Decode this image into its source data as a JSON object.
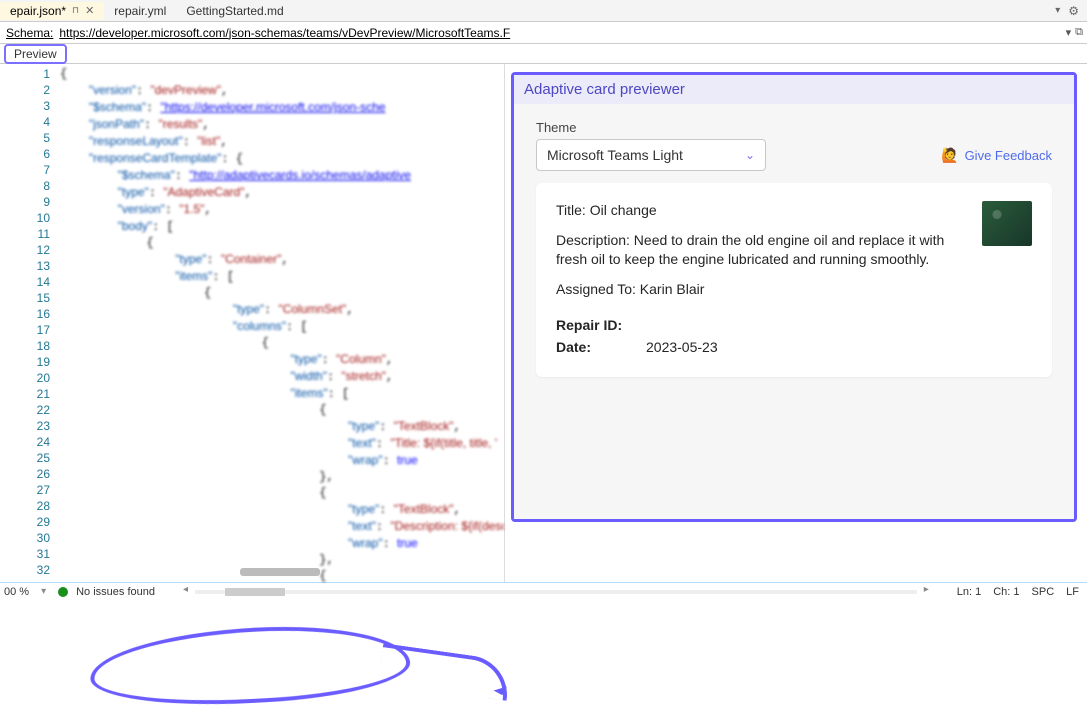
{
  "tabs": [
    {
      "label": "epair.json*",
      "active": true,
      "pinned": true,
      "closable": true
    },
    {
      "label": "repair.yml",
      "active": false
    },
    {
      "label": "GettingStarted.md",
      "active": false
    }
  ],
  "schema": {
    "label": "Schema:",
    "url": "https://developer.microsoft.com/json-schemas/teams/vDevPreview/MicrosoftTeams.F"
  },
  "preview_link": "Preview",
  "editor": {
    "lines": [
      "1",
      "2",
      "3",
      "4",
      "5",
      "6",
      "7",
      "8",
      "9",
      "10",
      "11",
      "12",
      "13",
      "14",
      "15",
      "16",
      "17",
      "18",
      "19",
      "20",
      "21",
      "22",
      "23",
      "24",
      "25",
      "26",
      "27",
      "28",
      "29",
      "30",
      "31",
      "32"
    ]
  },
  "code": {
    "l2": {
      "k": "\"version\"",
      "v": "\"devPreview\""
    },
    "l3": {
      "k": "\"$schema\"",
      "v": "\"https://developer.microsoft.com/json-sche"
    },
    "l4": {
      "k": "\"jsonPath\"",
      "v": "\"results\""
    },
    "l5": {
      "k": "\"responseLayout\"",
      "v": "\"list\""
    },
    "l6": {
      "k": "\"responseCardTemplate\"",
      "v": "{"
    },
    "l7": {
      "k": "\"$schema\"",
      "v": "\"http://adaptivecards.io/schemas/adaptive"
    },
    "l8": {
      "k": "\"type\"",
      "v": "\"AdaptiveCard\""
    },
    "l9": {
      "k": "\"version\"",
      "v": "\"1.5\""
    },
    "l10": {
      "k": "\"body\"",
      "v": "["
    },
    "l12": {
      "k": "\"type\"",
      "v": "\"Container\""
    },
    "l13": {
      "k": "\"items\"",
      "v": "["
    },
    "l15": {
      "k": "\"type\"",
      "v": "\"ColumnSet\""
    },
    "l16": {
      "k": "\"columns\"",
      "v": "["
    },
    "l18": {
      "k": "\"type\"",
      "v": "\"Column\""
    },
    "l19": {
      "k": "\"width\"",
      "v": "\"stretch\""
    },
    "l20": {
      "k": "\"items\"",
      "v": "["
    },
    "l22": {
      "k": "\"type\"",
      "v": "\"TextBlock\""
    },
    "l23": {
      "k": "\"text\"",
      "v": "\"Title: ${if(title, title, '"
    },
    "l24": {
      "k": "\"wrap\"",
      "v": "true"
    },
    "l27": {
      "k": "\"type\"",
      "v": "\"TextBlock\""
    },
    "l28": {
      "k": "\"text\"",
      "v": "\"Description: ${if(descripti"
    },
    "l29": {
      "k": "\"wrap\"",
      "v": "true"
    }
  },
  "previewer": {
    "title": "Adaptive card previewer",
    "theme_label": "Theme",
    "theme_value": "Microsoft Teams Light",
    "feedback": "Give Feedback"
  },
  "card": {
    "title": "Title: Oil change",
    "desc": "Description: Need to drain the old engine oil and replace it with fresh oil to keep the engine lubricated and running smoothly.",
    "assigned": "Assigned To: Karin Blair",
    "facts": {
      "repair_label": "Repair ID:",
      "repair_value": "",
      "date_label": "Date:",
      "date_value": "2023-05-23"
    }
  },
  "status": {
    "zoom": "00 %",
    "issues": "No issues found",
    "ln": "Ln: 1",
    "ch": "Ch: 1",
    "spc": "SPC",
    "lf": "LF"
  }
}
